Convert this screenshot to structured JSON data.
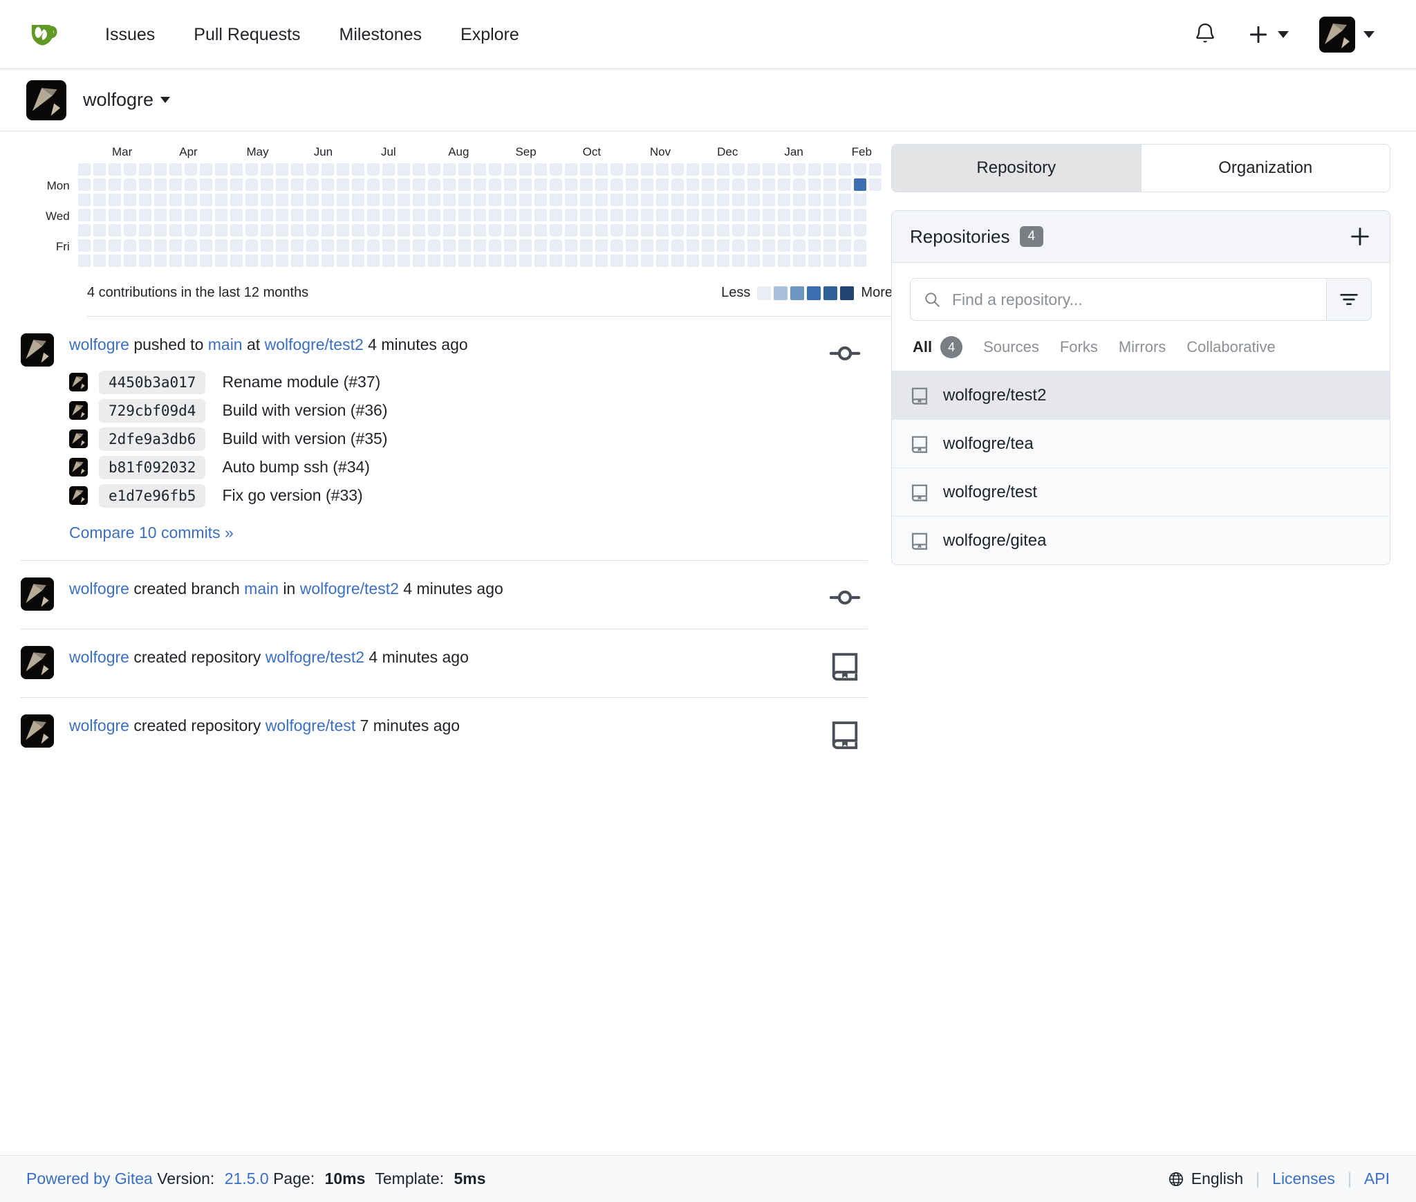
{
  "navbar": {
    "logo_icon": "gitea-logo-icon",
    "links": [
      {
        "label": "Issues"
      },
      {
        "label": "Pull Requests"
      },
      {
        "label": "Milestones"
      },
      {
        "label": "Explore"
      }
    ],
    "bell_icon": "bell-icon",
    "plus_icon": "plus-icon",
    "avatar_icon": "user-avatar"
  },
  "profile": {
    "username": "wolfogre"
  },
  "chart_data": {
    "type": "heatmap",
    "title": "Contribution activity heatmap",
    "months": [
      "Mar",
      "Apr",
      "May",
      "Jun",
      "Jul",
      "Aug",
      "Sep",
      "Oct",
      "Nov",
      "Dec",
      "Jan",
      "Feb"
    ],
    "day_labels": [
      "",
      "Mon",
      "",
      "Wed",
      "",
      "Fri",
      ""
    ],
    "weeks": 53,
    "days_per_week": 7,
    "summary": "4 contributions in the last 12 months",
    "total_contributions": 4,
    "legend_less": "Less",
    "legend_more": "More",
    "legend_colors": [
      "#e9edf5",
      "#a9c0dd",
      "#6e96c4",
      "#3b6fb0",
      "#2f6098",
      "#1f4470"
    ],
    "active_cells": [
      {
        "week": 51,
        "day": 1,
        "level": 3,
        "count": 4
      }
    ],
    "empty_color": "#e9edf5"
  },
  "activity": {
    "items": [
      {
        "icon": "commit-icon",
        "actor": "wolfogre",
        "action": "pushed to",
        "ref": "main",
        "preposition": "at",
        "repo": "wolfogre/test2",
        "time": "4 minutes ago",
        "commits": [
          {
            "sha": "4450b3a017",
            "message": "Rename module (#37)"
          },
          {
            "sha": "729cbf09d4",
            "message": "Build with version (#36)"
          },
          {
            "sha": "2dfe9a3db6",
            "message": "Build with version (#35)"
          },
          {
            "sha": "b81f092032",
            "message": "Auto bump ssh (#34)"
          },
          {
            "sha": "e1d7e96fb5",
            "message": "Fix go version (#33)"
          }
        ],
        "compare_label": "Compare 10 commits »"
      },
      {
        "icon": "commit-icon",
        "actor": "wolfogre",
        "action": "created branch",
        "ref": "main",
        "preposition": "in",
        "repo": "wolfogre/test2",
        "time": "4 minutes ago"
      },
      {
        "icon": "repo-icon",
        "actor": "wolfogre",
        "action": "created repository",
        "repo": "wolfogre/test2",
        "time": "4 minutes ago"
      },
      {
        "icon": "repo-icon",
        "actor": "wolfogre",
        "action": "created repository",
        "repo": "wolfogre/test",
        "time": "7 minutes ago"
      }
    ]
  },
  "sidebar": {
    "tabs": [
      {
        "label": "Repository",
        "active": true
      },
      {
        "label": "Organization",
        "active": false
      }
    ],
    "repositories_panel": {
      "title": "Repositories",
      "count": "4",
      "add_icon": "plus-icon",
      "search_placeholder": "Find a repository...",
      "search_value": "",
      "search_icon": "search-icon",
      "filter_icon": "filter-icon",
      "filter_tabs": [
        {
          "label": "All",
          "badge": "4",
          "active": true
        },
        {
          "label": "Sources",
          "badge": "",
          "active": false
        },
        {
          "label": "Forks",
          "badge": "",
          "active": false
        },
        {
          "label": "Mirrors",
          "badge": "",
          "active": false
        },
        {
          "label": "Collaborative",
          "badge": "",
          "active": false
        }
      ],
      "items": [
        {
          "name": "wolfogre/test2",
          "icon": "repo-icon",
          "selected": true
        },
        {
          "name": "wolfogre/tea",
          "icon": "repo-icon",
          "selected": false
        },
        {
          "name": "wolfogre/test",
          "icon": "repo-icon",
          "selected": false
        },
        {
          "name": "wolfogre/gitea",
          "icon": "repo-icon",
          "selected": false
        }
      ]
    }
  },
  "footer": {
    "powered_by": "Powered by Gitea",
    "version_label": "Version:",
    "version": "21.5.0",
    "page_label": "Page:",
    "page_time": "10ms",
    "template_label": "Template:",
    "template_time": "5ms",
    "language": "English",
    "language_icon": "globe-icon",
    "licenses": "Licenses",
    "api": "API"
  },
  "colors": {
    "link": "#3b6fc4",
    "brand_green": "#609926",
    "border": "#d8e0ec",
    "heatmap_empty": "#e9edf5"
  }
}
